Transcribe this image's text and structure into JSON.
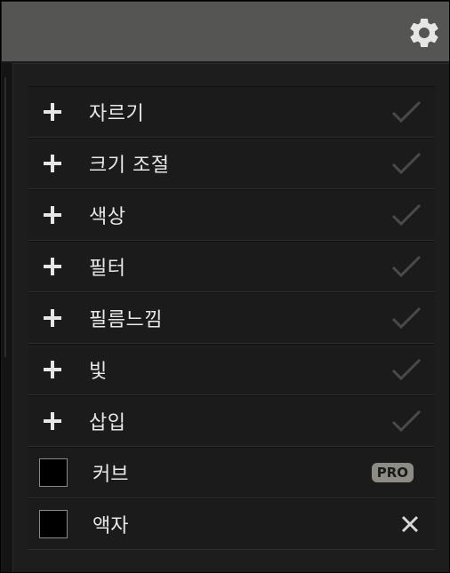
{
  "header": {
    "settings_icon": "gear-icon",
    "colors": {
      "bar": "#555553",
      "icon": "#e6e6e6"
    }
  },
  "menu": {
    "items": [
      {
        "label": "자르기",
        "icon": "plus-icon",
        "status": "check"
      },
      {
        "label": "크기 조절",
        "icon": "plus-icon",
        "status": "check"
      },
      {
        "label": "색상",
        "icon": "plus-icon",
        "status": "check"
      },
      {
        "label": "필터",
        "icon": "plus-icon",
        "status": "check"
      },
      {
        "label": "필름느낌",
        "icon": "plus-icon",
        "status": "check"
      },
      {
        "label": "빛",
        "icon": "plus-icon",
        "status": "check"
      },
      {
        "label": "삽입",
        "icon": "plus-icon",
        "status": "check"
      }
    ],
    "extras": [
      {
        "label": "커브",
        "badge": "PRO",
        "checked": false
      },
      {
        "label": "액자",
        "action_icon": "close-icon",
        "checked": false
      }
    ]
  }
}
